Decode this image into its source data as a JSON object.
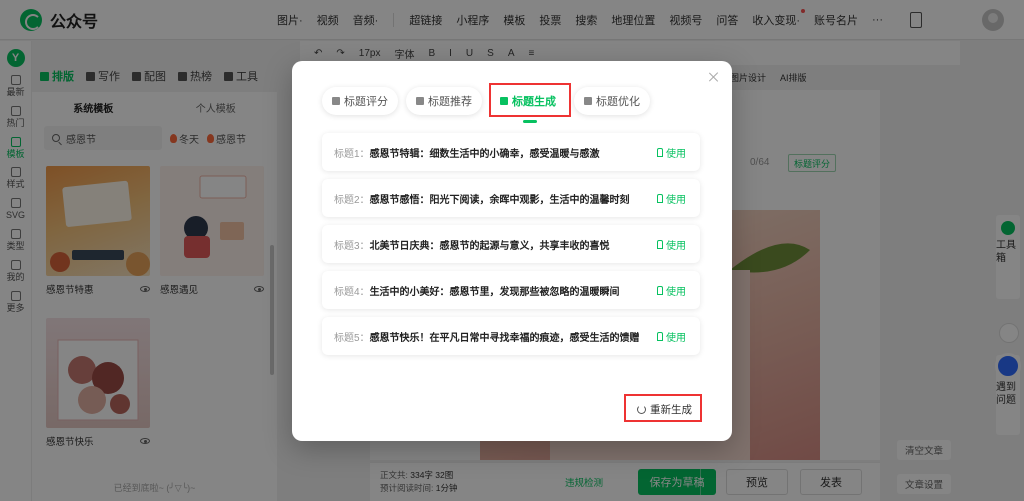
{
  "app": {
    "title": "公众号"
  },
  "topnav": {
    "items": [
      "图片·",
      "视频",
      "音频·",
      "超链接",
      "小程序",
      "模板",
      "投票",
      "搜索",
      "地理位置",
      "视频号",
      "问答",
      "收入变现·",
      "账号名片",
      "···"
    ]
  },
  "tooltabs": [
    "排版",
    "写作",
    "配图",
    "热榜",
    "工具"
  ],
  "rail": [
    "最新",
    "热门",
    "模板",
    "样式",
    "SVG",
    "类型",
    "我的",
    "更多"
  ],
  "panel": {
    "tabs": [
      "系统模板",
      "个人模板"
    ],
    "search_value": "感恩节",
    "hot_tags": [
      "冬天",
      "感恩节"
    ],
    "cards": [
      "感恩节特惠",
      "感恩遇见",
      "感恩节快乐"
    ],
    "footer": "已经到底啦~ (╯▽╰)~"
  },
  "editor": {
    "toolbar": [
      "17px",
      "字体",
      "B",
      "I",
      "U",
      "S",
      "A",
      "≡"
    ],
    "toolbar2": [
      "图片设计",
      "AI排版"
    ],
    "title_count": "0/64",
    "title_score_btn": "标题评分",
    "stats": {
      "label1": "正文共:",
      "value1": "334字 32图",
      "label2": "预计阅读时间:",
      "value2": "1分钟"
    },
    "violation": "违规检测",
    "save": "保存为草稿",
    "preview": "预览",
    "publish": "发表",
    "clear": "清空文章",
    "settings": "文章设置",
    "side_tool": "工具箱",
    "side_help": "遇到问题"
  },
  "modal": {
    "tabs": [
      "标题评分",
      "标题推荐",
      "标题生成",
      "标题优化"
    ],
    "active_tab": "标题生成",
    "titles": [
      {
        "label": "标题1：",
        "text": "感恩节特辑：细数生活中的小确幸，感受温暖与感激",
        "action": "使用"
      },
      {
        "label": "标题2：",
        "text": "感恩节感悟：阳光下阅读，余晖中观影，生活中的温馨时刻",
        "action": "使用"
      },
      {
        "label": "标题3：",
        "text": "北美节日庆典：感恩节的起源与意义，共享丰收的喜悦",
        "action": "使用"
      },
      {
        "label": "标题4：",
        "text": "生活中的小美好：感恩节里，发现那些被忽略的温暖瞬间",
        "action": "使用"
      },
      {
        "label": "标题5：",
        "text": "感恩节快乐！在平凡日常中寻找幸福的痕迹，感受生活的馈赠",
        "action": "使用"
      }
    ],
    "regenerate": "重新生成"
  },
  "colors": {
    "brand": "#07c160",
    "highlight": "#ee3333",
    "overlay": "rgba(0,0,0,0.48)"
  }
}
